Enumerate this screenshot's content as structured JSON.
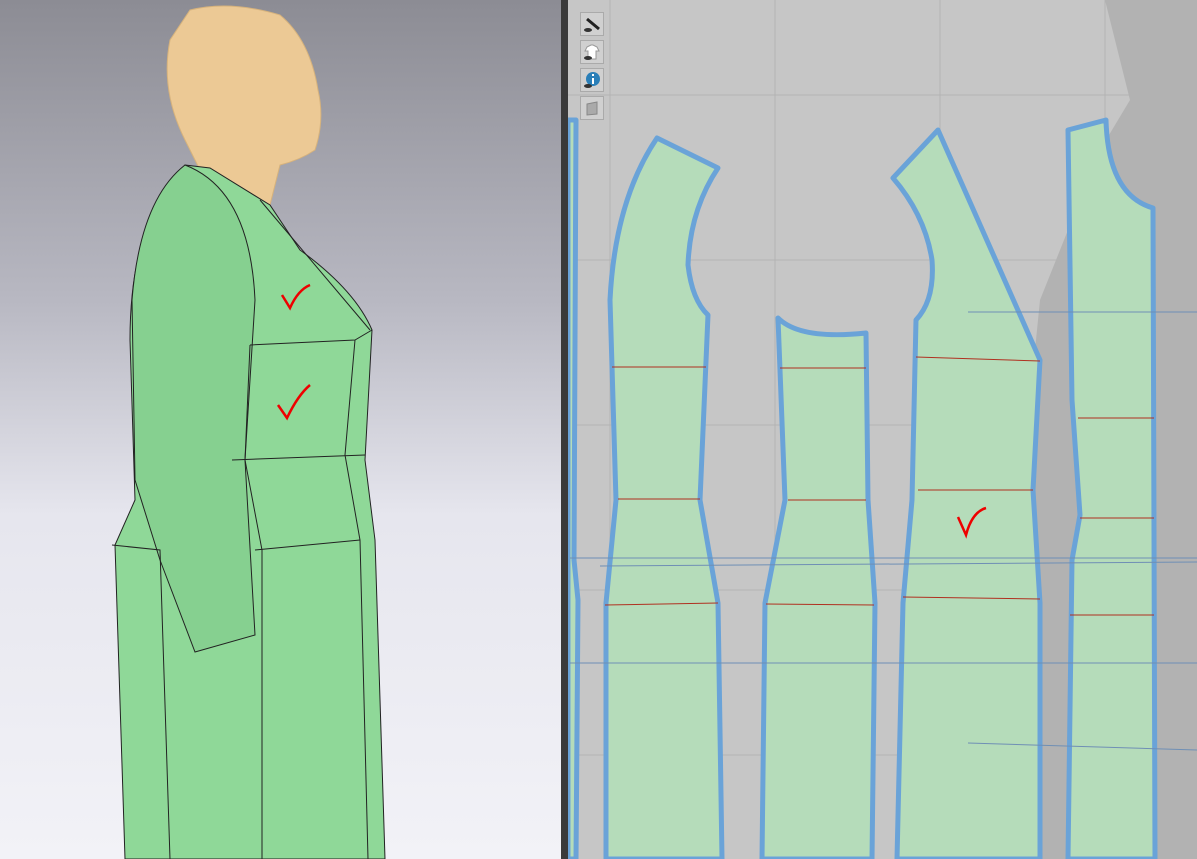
{
  "viewport_3d": {
    "garment_color": "#8fd898",
    "avatar_color": "#ecc995",
    "annotation_marks": [
      "checkmark",
      "checkmark"
    ]
  },
  "viewport_2d": {
    "piece_fill": "#b5dcba",
    "piece_outline": "#6aa3d8",
    "toolbar": [
      {
        "icon": "show-avatar-icon"
      },
      {
        "icon": "show-garment-icon"
      },
      {
        "icon": "show-info-icon"
      },
      {
        "icon": "texture-icon"
      }
    ],
    "annotation_marks": [
      "checkmark"
    ]
  }
}
